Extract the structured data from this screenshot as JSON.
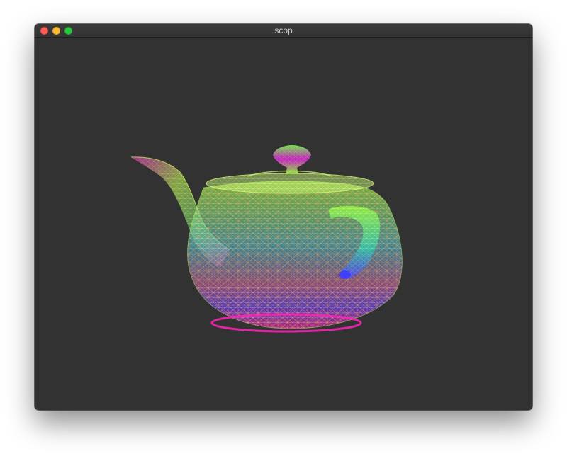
{
  "window": {
    "title": "scop"
  },
  "colors": {
    "window_background": "#323232",
    "close": "#fe5f57",
    "minimize": "#febc2e",
    "maximize": "#28c840",
    "mesh_top": "#9cff3a",
    "mesh_mid": "#39c8d8",
    "mesh_wire": "#e08a3c",
    "mesh_bottom": "#ff1fc0"
  },
  "viewport": {
    "object": "teapot-wireframe"
  }
}
